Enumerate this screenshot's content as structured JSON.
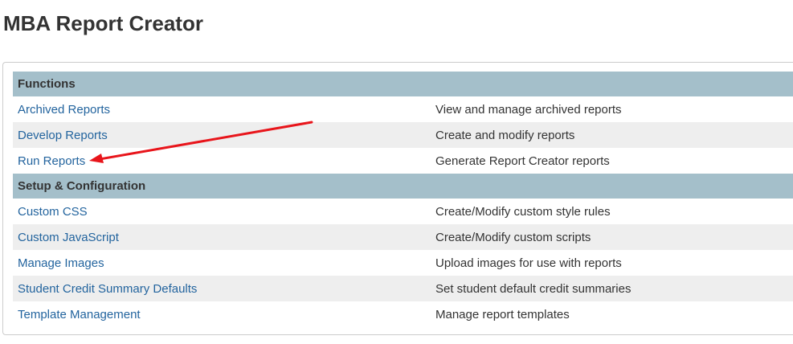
{
  "page": {
    "title": "MBA Report Creator"
  },
  "sections": [
    {
      "header": "Functions",
      "items": [
        {
          "link": "Archived Reports",
          "description": "View and manage archived reports"
        },
        {
          "link": "Develop Reports",
          "description": "Create and modify reports"
        },
        {
          "link": "Run Reports",
          "description": "Generate Report Creator reports"
        }
      ]
    },
    {
      "header": "Setup & Configuration",
      "items": [
        {
          "link": "Custom CSS",
          "description": "Create/Modify custom style rules"
        },
        {
          "link": "Custom JavaScript",
          "description": "Create/Modify custom scripts"
        },
        {
          "link": "Manage Images",
          "description": "Upload images for use with reports"
        },
        {
          "link": "Student Credit Summary Defaults",
          "description": "Set student default credit summaries"
        },
        {
          "link": "Template Management",
          "description": "Manage report templates"
        }
      ]
    }
  ],
  "annotation": {
    "type": "arrow",
    "color": "#e8151b",
    "points_to": "Run Reports"
  },
  "colors": {
    "header_bg": "#a4bfca",
    "link": "#23649e",
    "stripe": "#eeeeee"
  }
}
